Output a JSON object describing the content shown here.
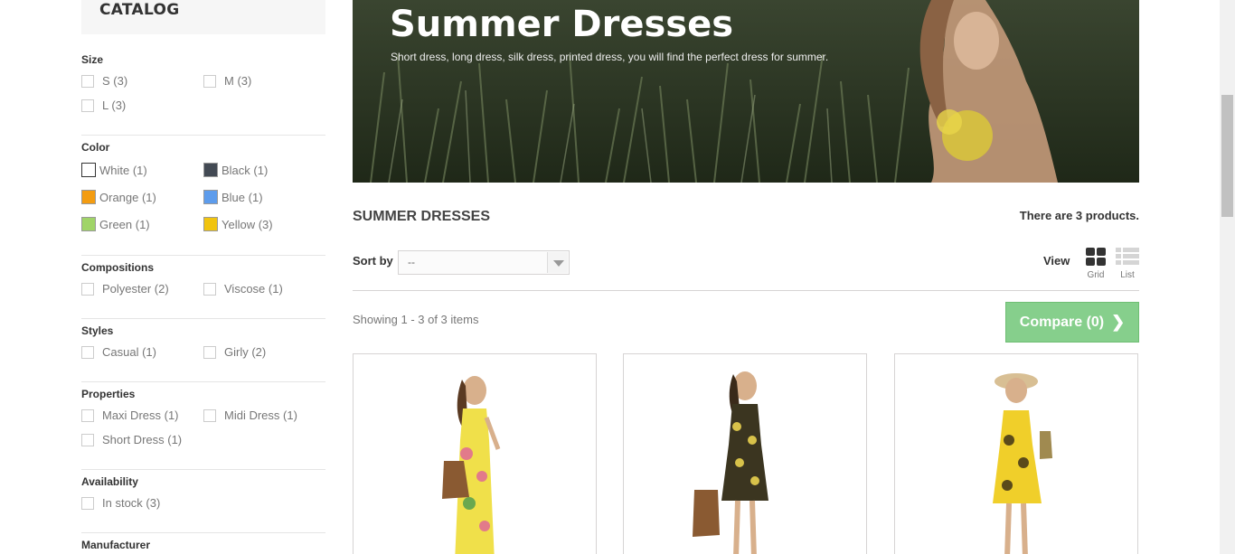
{
  "sidebar": {
    "catalog_title": "CATALOG",
    "groups": [
      {
        "title": "Size",
        "options": [
          "S (3)",
          "M (3)",
          "L (3)"
        ]
      },
      {
        "title": "Color",
        "options": [
          "White (1)",
          "Black (1)",
          "Orange (1)",
          "Blue (1)",
          "Green (1)",
          "Yellow (3)"
        ],
        "swatches": [
          "#ffffff",
          "#434a54",
          "#f39c11",
          "#5d9cec",
          "#a0d468",
          "#f1c40f"
        ]
      },
      {
        "title": "Compositions",
        "options": [
          "Polyester (2)",
          "Viscose (1)"
        ]
      },
      {
        "title": "Styles",
        "options": [
          "Casual (1)",
          "Girly (2)"
        ]
      },
      {
        "title": "Properties",
        "options": [
          "Maxi Dress (1)",
          "Midi Dress (1)",
          "Short Dress (1)"
        ]
      },
      {
        "title": "Availability",
        "options": [
          "In stock (3)"
        ]
      },
      {
        "title": "Manufacturer",
        "options": []
      }
    ]
  },
  "banner": {
    "title": "Summer Dresses",
    "description": "Short dress, long dress, silk dress, printed dress, you will find the perfect dress for summer."
  },
  "category": {
    "name": "SUMMER DRESSES",
    "count_text": "There are 3 products."
  },
  "toolbar": {
    "sort_label": "Sort by",
    "sort_value": "--",
    "view_label": "View",
    "grid_label": "Grid",
    "list_label": "List",
    "showing_text": "Showing 1 - 3 of 3 items",
    "compare_label": "Compare (0)"
  },
  "colors": {
    "compare": "#86cf8c",
    "accent": "#333333"
  },
  "products": [
    {
      "dress": "yellow-floral-maxi",
      "main_color": "#f0e04a",
      "accent_color": "#e27a8a"
    },
    {
      "dress": "black-yellow-print-midi",
      "main_color": "#3b3520",
      "accent_color": "#d8c24a"
    },
    {
      "dress": "yellow-print-short",
      "main_color": "#f0cf2a",
      "accent_color": "#5a4a1a"
    }
  ]
}
